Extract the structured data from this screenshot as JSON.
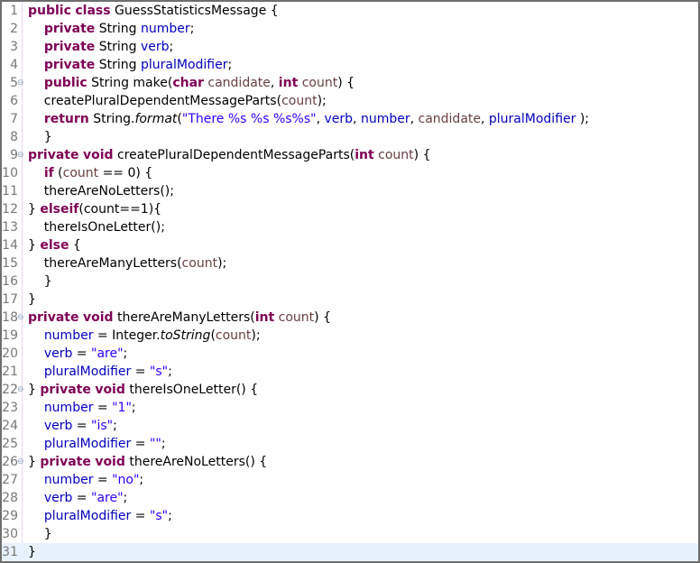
{
  "editor": {
    "lines": [
      {
        "n": "1",
        "fold": "",
        "html": "<span class=\"kw\">public</span> <span class=\"kw\">class</span> GuessStatisticsMessage {"
      },
      {
        "n": "2",
        "fold": "",
        "html": "    <span class=\"kw\">private</span> String <span class=\"fld\">number</span>;"
      },
      {
        "n": "3",
        "fold": "",
        "html": "    <span class=\"kw\">private</span> String <span class=\"fld\">verb</span>;"
      },
      {
        "n": "4",
        "fold": "",
        "html": "    <span class=\"kw\">private</span> String <span class=\"fld\">pluralModifier</span>;"
      },
      {
        "n": "5",
        "fold": "⊖",
        "html": "    <span class=\"kw\">public</span> String make(<span class=\"kw\">char</span> <span class=\"loc\">candidate</span>, <span class=\"kw\">int</span> <span class=\"loc\">count</span>) {"
      },
      {
        "n": "6",
        "fold": "",
        "html": "    createPluralDependentMessageParts(<span class=\"loc\">count</span>);"
      },
      {
        "n": "7",
        "fold": "",
        "html": "    <span class=\"kw\">return</span> String.<span class=\"it\">format</span>(<span class=\"str\">\"There %s %s %s%s\"</span>, <span class=\"fld\">verb</span>, <span class=\"fld\">number</span>, <span class=\"loc\">candidate</span>, <span class=\"fld\">pluralModifier</span> );"
      },
      {
        "n": "8",
        "fold": "",
        "html": "    }"
      },
      {
        "n": "9",
        "fold": "⊖",
        "html": "<span class=\"kw\">private</span> <span class=\"kw\">void</span> createPluralDependentMessageParts(<span class=\"kw\">int</span> <span class=\"loc\">count</span>) {"
      },
      {
        "n": "10",
        "fold": "",
        "html": "    <span class=\"kw\">if</span> (<span class=\"loc\">count</span> == 0) {"
      },
      {
        "n": "11",
        "fold": "",
        "html": "    thereAreNoLetters();"
      },
      {
        "n": "12",
        "fold": "",
        "html": "} <span class=\"kw\">elseif</span>(count==1){"
      },
      {
        "n": "13",
        "fold": "",
        "html": "    thereIsOneLetter();"
      },
      {
        "n": "14",
        "fold": "",
        "html": "} <span class=\"kw\">else</span> {"
      },
      {
        "n": "15",
        "fold": "",
        "html": "    thereAreManyLetters(<span class=\"loc\">count</span>);"
      },
      {
        "n": "16",
        "fold": "",
        "html": "    }"
      },
      {
        "n": "17",
        "fold": "",
        "html": "}"
      },
      {
        "n": "18",
        "fold": "⊖",
        "html": "<span class=\"kw\">private</span> <span class=\"kw\">void</span> thereAreManyLetters(<span class=\"kw\">int</span> <span class=\"loc\">count</span>) {"
      },
      {
        "n": "19",
        "fold": "",
        "html": "    <span class=\"fld\">number</span> = Integer.<span class=\"it\">toString</span>(<span class=\"loc\">count</span>);"
      },
      {
        "n": "20",
        "fold": "",
        "html": "    <span class=\"fld\">verb</span> = <span class=\"str\">\"are\"</span>;"
      },
      {
        "n": "21",
        "fold": "",
        "html": "    <span class=\"fld\">pluralModifier</span> = <span class=\"str\">\"s\"</span>;"
      },
      {
        "n": "22",
        "fold": "⊖",
        "html": "} <span class=\"kw\">private</span> <span class=\"kw\">void</span> thereIsOneLetter() {"
      },
      {
        "n": "23",
        "fold": "",
        "html": "    <span class=\"fld\">number</span> = <span class=\"str\">\"1\"</span>;"
      },
      {
        "n": "24",
        "fold": "",
        "html": "    <span class=\"fld\">verb</span> = <span class=\"str\">\"is\"</span>;"
      },
      {
        "n": "25",
        "fold": "",
        "html": "    <span class=\"fld\">pluralModifier</span> = <span class=\"str\">\"\"</span>;"
      },
      {
        "n": "26",
        "fold": "⊖",
        "html": "} <span class=\"kw\">private</span> <span class=\"kw\">void</span> thereAreNoLetters() {"
      },
      {
        "n": "27",
        "fold": "",
        "html": "    <span class=\"fld\">number</span> = <span class=\"str\">\"no\"</span>;"
      },
      {
        "n": "28",
        "fold": "",
        "html": "    <span class=\"fld\">verb</span> = <span class=\"str\">\"are\"</span>;"
      },
      {
        "n": "29",
        "fold": "",
        "html": "    <span class=\"fld\">pluralModifier</span> = <span class=\"str\">\"s\"</span>;"
      },
      {
        "n": "30",
        "fold": "",
        "html": "    }"
      },
      {
        "n": "31",
        "fold": "",
        "html": "}",
        "current": true
      }
    ]
  },
  "colors": {
    "keyword": "#7f0055",
    "field": "#0000c0",
    "string": "#2a00ff",
    "local_variable": "#6a3e3e",
    "line_number": "#787878",
    "current_line_highlight": "#e8f2fe"
  }
}
